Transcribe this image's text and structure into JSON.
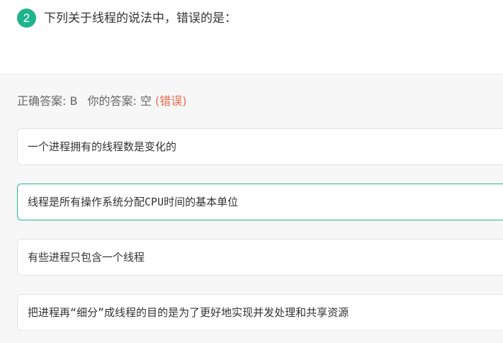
{
  "question": {
    "number": "2",
    "text": "下列关于线程的说法中，错误的是："
  },
  "answer": {
    "correct_label": "正确答案: B",
    "your_label": "你的答案: 空",
    "result": "(错误)"
  },
  "options": [
    {
      "text": "一个进程拥有的线程数是变化的"
    },
    {
      "text": "线程是所有操作系统分配CPU时间的基本单位"
    },
    {
      "text": "有些进程只包含一个线程"
    },
    {
      "text": "把进程再“细分”成线程的目的是为了更好地实现并发处理和共享资源"
    }
  ],
  "colors": {
    "accent": "#1fb48d",
    "wrong": "#f0694b",
    "correct_border": "#22b88f"
  }
}
